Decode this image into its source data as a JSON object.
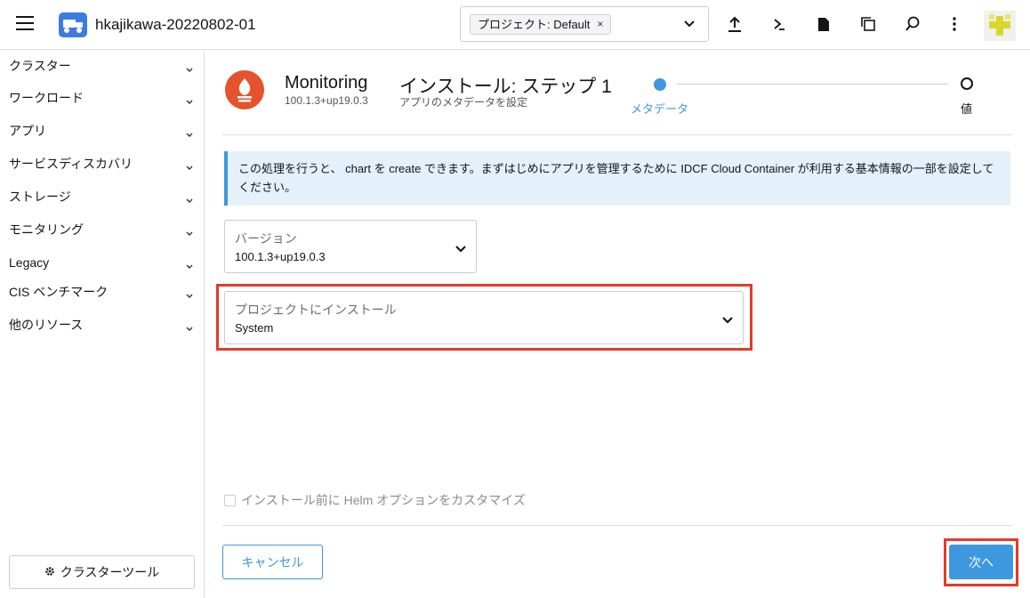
{
  "header": {
    "cluster_name": "hkajikawa-20220802-01",
    "project_chip": "プロジェクト: Default",
    "project_chip_remove": "×",
    "icons": [
      "upload-icon",
      "terminal-icon",
      "file-icon",
      "copy-icon",
      "search-icon",
      "more-vert-icon"
    ]
  },
  "sidebar": {
    "items": [
      {
        "label": "クラスター"
      },
      {
        "label": "ワークロード"
      },
      {
        "label": "アプリ"
      },
      {
        "label": "サービスディスカバリ"
      },
      {
        "label": "ストレージ"
      },
      {
        "label": "モニタリング"
      },
      {
        "label": "Legacy"
      },
      {
        "label": "CIS ベンチマーク"
      },
      {
        "label": "他のリソース"
      }
    ],
    "cluster_tools_label": "クラスターツール"
  },
  "app": {
    "name": "Monitoring",
    "version": "100.1.3+up19.0.3",
    "step_title": "インストール: ステップ 1",
    "step_subtitle": "アプリのメタデータを設定"
  },
  "stepper": {
    "steps": [
      {
        "label": "メタデータ",
        "active": true
      },
      {
        "label": "値",
        "active": false
      }
    ]
  },
  "banner": {
    "text": "この処理を行うと、 chart を create できます。まずはじめにアプリを管理するために IDCF Cloud Container が利用する基本情報の一部を設定してください。"
  },
  "form": {
    "version_label": "バージョン",
    "version_value": "100.1.3+up19.0.3",
    "project_label": "プロジェクトにインストール",
    "project_value": "System",
    "helm_option_label": "インストール前に Helm オプションをカスタマイズ",
    "helm_option_checked": false
  },
  "footer": {
    "cancel_label": "キャンセル",
    "next_label": "次へ"
  },
  "colors": {
    "accent": "#3d98e0",
    "highlight": "#e53a2a",
    "app_logo": "#e6522c",
    "banner_bg": "#e4f1fb"
  }
}
